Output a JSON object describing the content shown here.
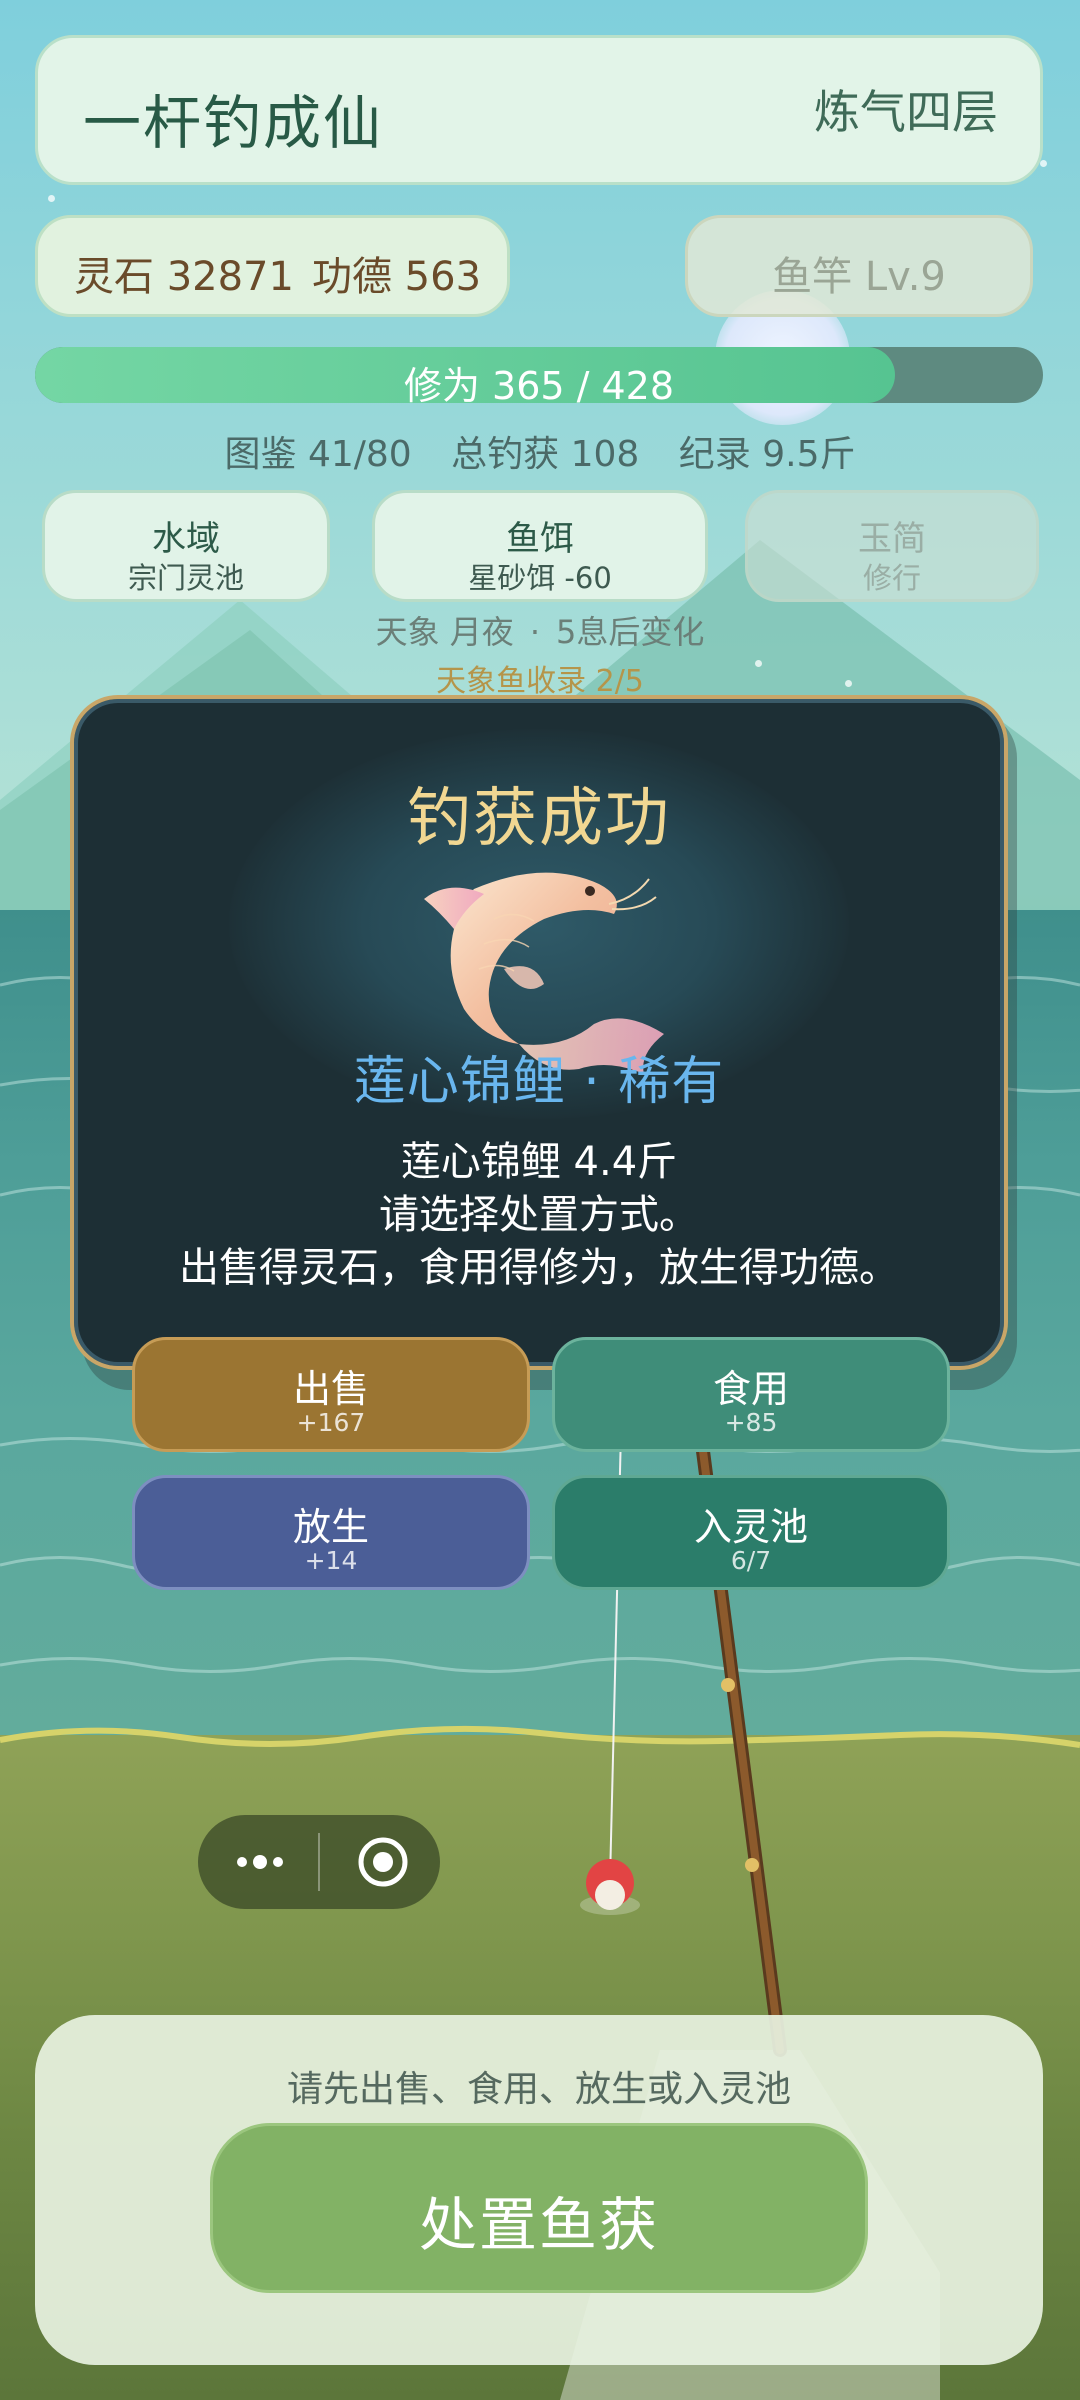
{
  "header": {
    "title": "一杆钓成仙",
    "realm": "炼气四层"
  },
  "stats": {
    "spirit_stones": "灵石 32871",
    "merit": "功德 563",
    "rod": "鱼竿 Lv.9"
  },
  "cultivation": {
    "label": "修为 365 / 428",
    "current": 365,
    "max": 428
  },
  "summary": {
    "catalog": "图鉴 41/80",
    "total_catch": "总钓获 108",
    "record": "纪录 9.5斤"
  },
  "tabs": [
    {
      "title": "水域",
      "value": "宗门灵池",
      "active": true
    },
    {
      "title": "鱼饵",
      "value": "星砂饵 -60",
      "active": true
    },
    {
      "title": "玉简",
      "value": "修行",
      "active": false
    }
  ],
  "weather": {
    "label": "天象 月夜",
    "dot": "·",
    "countdown": "5息后变化"
  },
  "collection": "天象鱼收录 2/5",
  "dialog": {
    "title": "钓获成功",
    "fish_name": "莲心锦鲤 · 稀有",
    "line1": "莲心锦鲤 4.4斤",
    "line2": "请选择处置方式。",
    "line3": "出售得灵石，食用得修为，放生得功德。",
    "fish_icon": "koi-fish-icon"
  },
  "actions": [
    {
      "label": "出售",
      "value": "+167",
      "color": "#9b7532"
    },
    {
      "label": "食用",
      "value": "+85",
      "color": "#3f8d79"
    },
    {
      "label": "放生",
      "value": "+14",
      "color": "#4b5e97"
    },
    {
      "label": "入灵池",
      "value": "6/7",
      "color": "#2b7d6a"
    }
  ],
  "capsule": {
    "more_icon": "more-dots-icon",
    "close_icon": "target-close-icon"
  },
  "bottom": {
    "hint": "请先出售、食用、放生或入灵池",
    "button": "处置鱼获"
  }
}
